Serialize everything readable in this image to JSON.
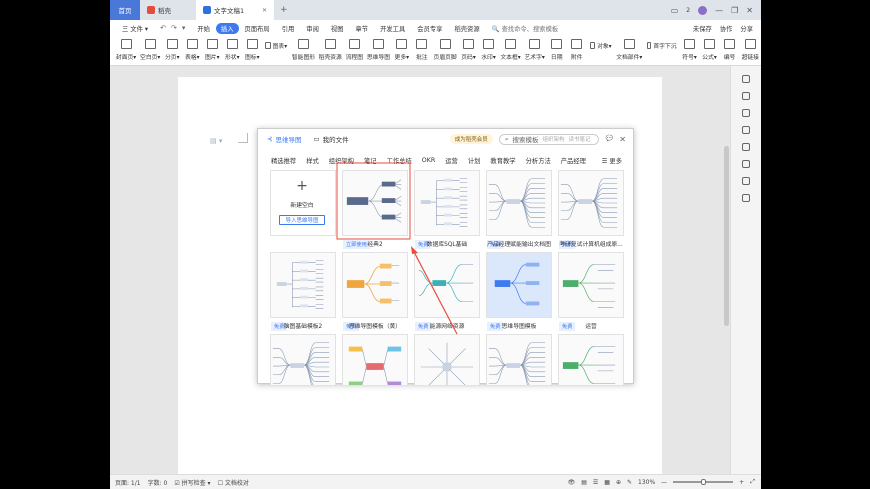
{
  "titlebar": {
    "tabs": [
      {
        "label": "首页"
      },
      {
        "label": "稻壳"
      },
      {
        "label": "文字文稿1"
      }
    ],
    "right": {
      "badge": "2",
      "window_controls": [
        "—",
        "❐",
        "✕"
      ]
    }
  },
  "menubar": {
    "file": "三 文件 ▾",
    "quick_icons": [
      "↶",
      "↷",
      "▾"
    ],
    "items": [
      "开始",
      "插入",
      "页面布局",
      "引用",
      "审阅",
      "视图",
      "章节",
      "开发工具",
      "会员专享",
      "稻壳资源"
    ],
    "active": "插入",
    "search": "查找命令、搜索模板",
    "right": [
      "未保存",
      "协作",
      "分享"
    ]
  },
  "ribbon": {
    "buttons": [
      "封面页▾",
      "空白页▾",
      "分页▾",
      "表格▾",
      "图片▾",
      "形状▾",
      "图标▾",
      "智能图形",
      "稻壳资源",
      "流程图",
      "思维导图",
      "更多▾",
      "批注",
      "页眉页脚",
      "页码▾",
      "水印▾",
      "文本框▾",
      "艺术字▾",
      "日期",
      "附件",
      "文档部件▾",
      "符号▾",
      "公式▾",
      "编号",
      "超链接"
    ],
    "small": [
      "图表▾",
      "对象▾",
      "首字下沉"
    ]
  },
  "dialog": {
    "brand": "思维导图",
    "my_files": "我的文件",
    "vip": "成为稻壳会员",
    "search_placeholder": "搜索模板",
    "search_hints": [
      "组织架构",
      "读书笔记"
    ],
    "header_buttons": [
      "💬",
      "✕"
    ],
    "categories": [
      "精选推荐",
      "样式",
      "组织架构",
      "笔记",
      "工作总结",
      "OKR",
      "运营",
      "计划",
      "教育教学",
      "分析方法",
      "产品经理"
    ],
    "more": "☰ 更多",
    "new_blank": {
      "plus": "+",
      "label": "新建空白",
      "import": "导入思维导图"
    },
    "cards": [
      {
        "caption": "经典2",
        "tag": "立即使用",
        "style": "classic"
      },
      {
        "caption": "数据库SQL基础",
        "tag": "免费",
        "style": "tree"
      },
      {
        "caption": "产品经理赋能输出文档图",
        "tag": "免费",
        "style": "mind"
      },
      {
        "caption": "考研复试计算机组成原...",
        "tag": "免费",
        "style": "mind"
      },
      {
        "caption": "脑图基础模板2",
        "tag": "免费",
        "style": "tree2"
      },
      {
        "caption": "思维导图模板（黄）",
        "tag": "免费",
        "style": "orange"
      },
      {
        "caption": "能源网络资源",
        "tag": "免费",
        "style": "teal"
      },
      {
        "caption": "思维导图模板",
        "tag": "免费",
        "style": "blue"
      },
      {
        "caption": "运营",
        "tag": "免费",
        "style": "green"
      },
      {
        "caption": "",
        "tag": "",
        "style": "mind"
      },
      {
        "caption": "",
        "tag": "",
        "style": "colorful"
      },
      {
        "caption": "",
        "tag": "",
        "style": "map"
      },
      {
        "caption": "",
        "tag": "",
        "style": "mind"
      },
      {
        "caption": "",
        "tag": "",
        "style": "green"
      }
    ]
  },
  "statusbar": {
    "page": "页面: 1/1",
    "words": "字数: 0",
    "spell": "☑ 拼写检查 ▾",
    "proof": "☐ 文档校对",
    "zoom": "130%",
    "zoom_minus": "—",
    "zoom_plus": "+",
    "icons": [
      "👁",
      "▤",
      "☰",
      "▦",
      "⊕",
      "✎"
    ],
    "fit": "⤢"
  },
  "colors": {
    "accent": "#3d7af0",
    "highlight": "#e74c3c"
  }
}
